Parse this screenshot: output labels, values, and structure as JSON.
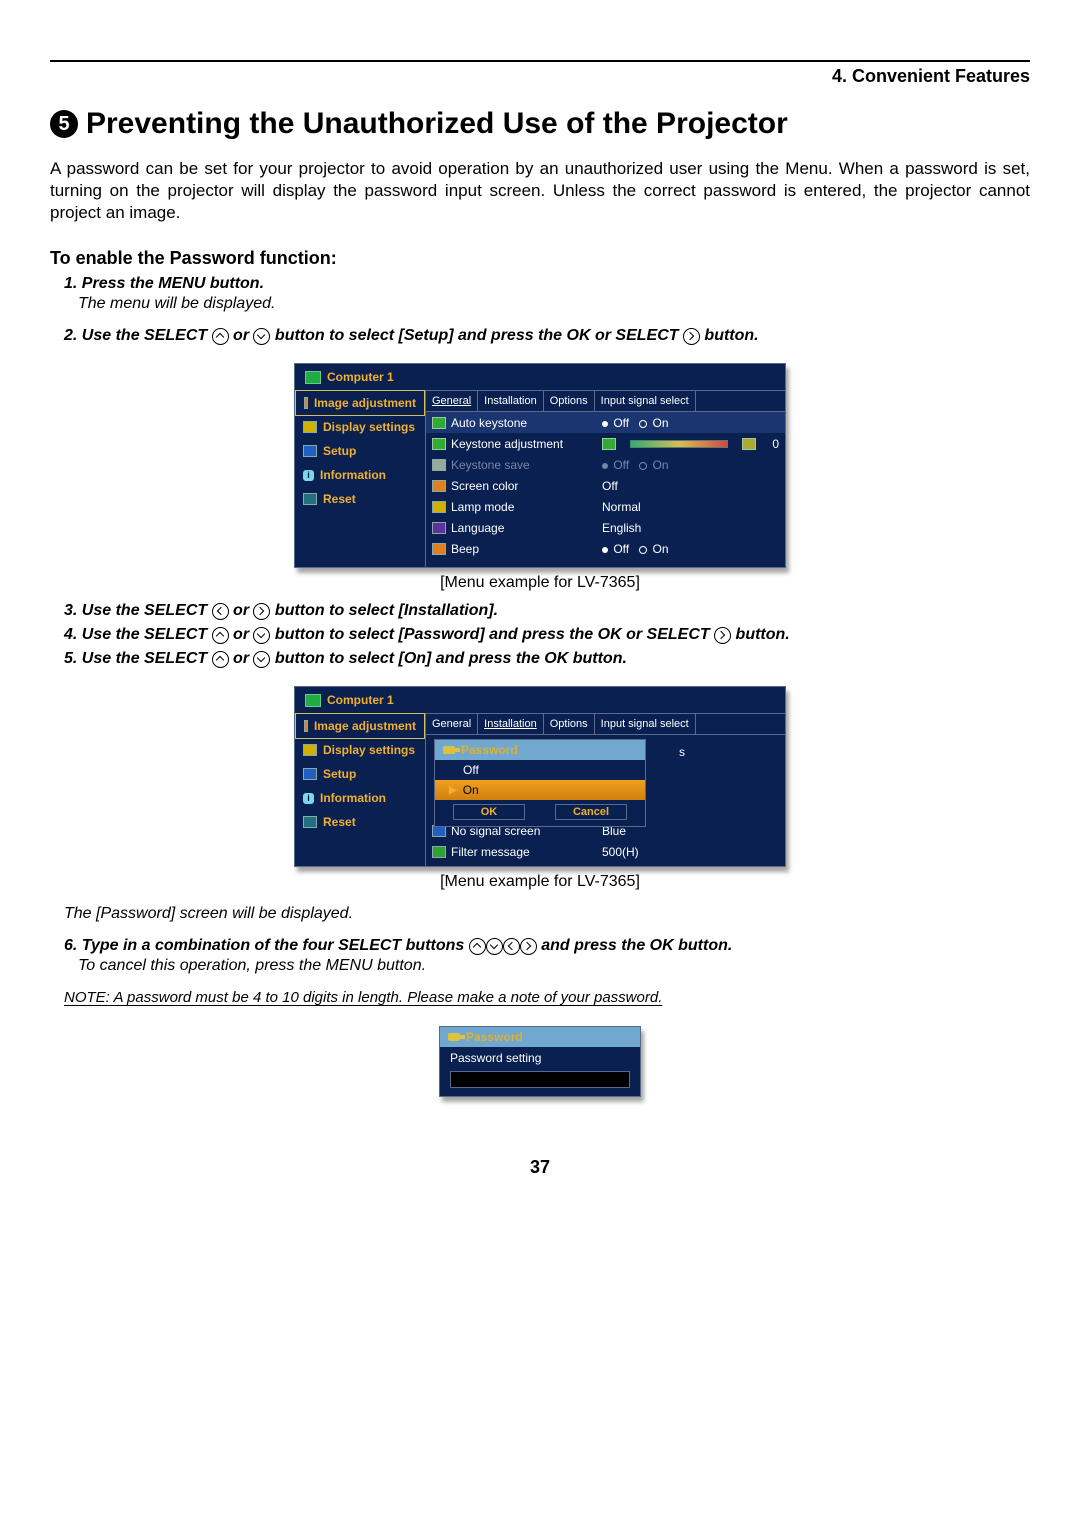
{
  "chapter": "4. Convenient Features",
  "section": {
    "num": "5",
    "title": "Preventing the Unauthorized Use of the Projector"
  },
  "intro": "A password can be set for your projector to avoid operation by an unauthorized user using the Menu. When a password is set, turning on the projector will display the password input screen. Unless the correct password is entered, the projector cannot project an image.",
  "sub_heading": "To enable the Password function:",
  "steps": {
    "s1": "1.  Press the MENU button.",
    "s1b": "The menu will be displayed.",
    "s2a": "2.  Use the SELECT ",
    "s2b": " or ",
    "s2c": " button to select [Setup] and press the OK or SELECT ",
    "s2d": " button.",
    "s3a": "3.  Use the SELECT ",
    "s3b": " or ",
    "s3c": " button to select [Installation].",
    "s4a": "4.  Use the SELECT ",
    "s4b": " or ",
    "s4c": " button to select  [Password] and press the OK or SELECT ",
    "s4d": " button.",
    "s5a": "5.  Use the SELECT ",
    "s5b": " or ",
    "s5c": " button to select [On] and press the OK button.",
    "s6a": "The [Password] screen will be displayed.",
    "s7a": "6.  Type in a combination of the four SELECT buttons  ",
    "s7b": " and press the OK button.",
    "s7c": "To cancel this operation, press the MENU button.",
    "note": "NOTE: A password must be 4 to 10  digits in length. Please make a note of your password."
  },
  "caption": "[Menu example for LV-7365]",
  "menu": {
    "source": "Computer 1",
    "side": [
      "Image adjustment",
      "Display settings",
      "Setup",
      "Information",
      "Reset"
    ],
    "tabs": [
      "General",
      "Installation",
      "Options",
      "Input signal select"
    ],
    "general": {
      "auto_keystone": {
        "label": "Auto keystone",
        "off": "Off",
        "on": "On"
      },
      "keystone_adj": {
        "label": "Keystone adjustment",
        "val": "0"
      },
      "keystone_save": {
        "label": "Keystone save",
        "off": "Off",
        "on": "On"
      },
      "screen_color": {
        "label": "Screen color",
        "val": "Off"
      },
      "lamp_mode": {
        "label": "Lamp mode",
        "val": "Normal"
      },
      "language": {
        "label": "Language",
        "val": "English"
      },
      "beep": {
        "label": "Beep",
        "off": "Off",
        "on": "On"
      }
    },
    "install_trail": {
      "s": "s",
      "no_signal": "No signal screen",
      "no_signal_v": "Blue",
      "filter": "Filter message",
      "filter_v": "500(H)"
    },
    "popup": {
      "title": "Password",
      "off": "Off",
      "on": "On",
      "ok": "OK",
      "cancel": "Cancel"
    }
  },
  "pwdbox": {
    "title": "Password",
    "label": "Password setting"
  },
  "page_num": "37"
}
